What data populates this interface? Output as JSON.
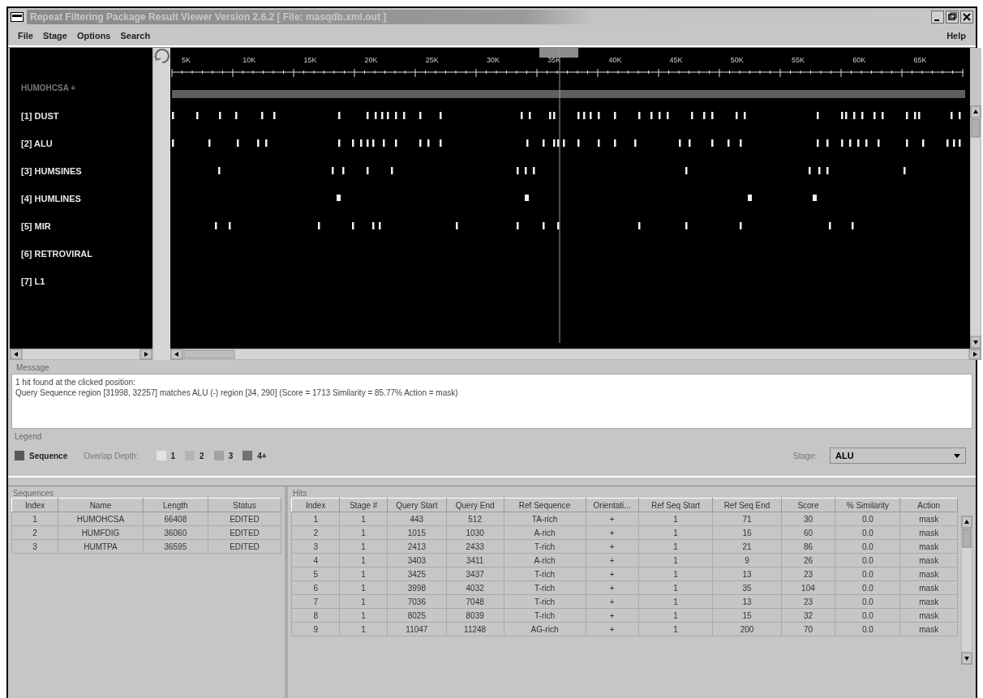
{
  "window": {
    "title": "Repeat Filtering Package Result Viewer Version 2.6.2 [ File: masqdb.xml.out ]"
  },
  "menu": {
    "left": [
      "File",
      "Stage",
      "Options",
      "Search"
    ],
    "right": [
      "Help"
    ]
  },
  "track_view": {
    "ruler_ticks": [
      "5K",
      "10K",
      "15K",
      "20K",
      "25K",
      "30K",
      "35K",
      "40K",
      "45K",
      "50K",
      "55K",
      "60K",
      "65K"
    ],
    "sequence_label": "HUMOHCSA +",
    "tracks": [
      {
        "label": "[1] DUST"
      },
      {
        "label": "[2] ALU"
      },
      {
        "label": "[3] HUMSINES"
      },
      {
        "label": "[4] HUMLINES"
      },
      {
        "label": "[5] MIR"
      },
      {
        "label": "[6] RETROVIRAL"
      },
      {
        "label": "[7] L1"
      }
    ]
  },
  "message": {
    "title": "Message",
    "lines": [
      "1 hit found at the clicked position:",
      "Query Sequence region [31998, 32257] matches ALU (-)  region [34, 290]  (Score = 1713 Similarity = 85.77% Action = mask)"
    ]
  },
  "legend": {
    "title": "Legend",
    "sequence": {
      "label": "Sequence",
      "color": "#5a5a5a"
    },
    "depth_label": "Overlap Depth:",
    "depths": [
      {
        "label": "1",
        "color": "#e2e2e2"
      },
      {
        "label": "2",
        "color": "#b4b4b4"
      },
      {
        "label": "3",
        "color": "#a2a2a2"
      },
      {
        "label": "4+",
        "color": "#717171"
      }
    ],
    "stage": {
      "label": "Stage:",
      "value": "ALU"
    }
  },
  "sequences": {
    "title": "Sequences",
    "columns": [
      "Index",
      "Name",
      "Length",
      "Status"
    ],
    "rows": [
      [
        "1",
        "HUMOHCSA",
        "66408",
        "EDITED"
      ],
      [
        "2",
        "HUMFDIG",
        "36060",
        "EDITED"
      ],
      [
        "3",
        "HUMTPA",
        "36595",
        "EDITED"
      ]
    ]
  },
  "hits": {
    "title": "Hits",
    "columns": [
      "Index",
      "Stage #",
      "Query Start",
      "Query End",
      "Ref Sequence",
      "Orientati...",
      "Ref Seq Start",
      "Ref Seq End",
      "Score",
      "% Similarity",
      "Action"
    ],
    "rows": [
      [
        "1",
        "1",
        "443",
        "512",
        "TA-rich",
        "+",
        "1",
        "71",
        "30",
        "0.0",
        "mask"
      ],
      [
        "2",
        "1",
        "1015",
        "1030",
        "A-rich",
        "+",
        "1",
        "16",
        "60",
        "0.0",
        "mask"
      ],
      [
        "3",
        "1",
        "2413",
        "2433",
        "T-rich",
        "+",
        "1",
        "21",
        "86",
        "0.0",
        "mask"
      ],
      [
        "4",
        "1",
        "3403",
        "3411",
        "A-rich",
        "+",
        "1",
        "9",
        "26",
        "0.0",
        "mask"
      ],
      [
        "5",
        "1",
        "3425",
        "3437",
        "T-rich",
        "+",
        "1",
        "13",
        "23",
        "0.0",
        "mask"
      ],
      [
        "6",
        "1",
        "3998",
        "4032",
        "T-rich",
        "+",
        "1",
        "35",
        "104",
        "0.0",
        "mask"
      ],
      [
        "7",
        "1",
        "7036",
        "7048",
        "T-rich",
        "+",
        "1",
        "13",
        "23",
        "0.0",
        "mask"
      ],
      [
        "8",
        "1",
        "8025",
        "8039",
        "T-rich",
        "+",
        "1",
        "15",
        "32",
        "0.0",
        "mask"
      ],
      [
        "9",
        "1",
        "11047",
        "11248",
        "AG-rich",
        "+",
        "1",
        "200",
        "70",
        "0.0",
        "mask"
      ]
    ]
  }
}
